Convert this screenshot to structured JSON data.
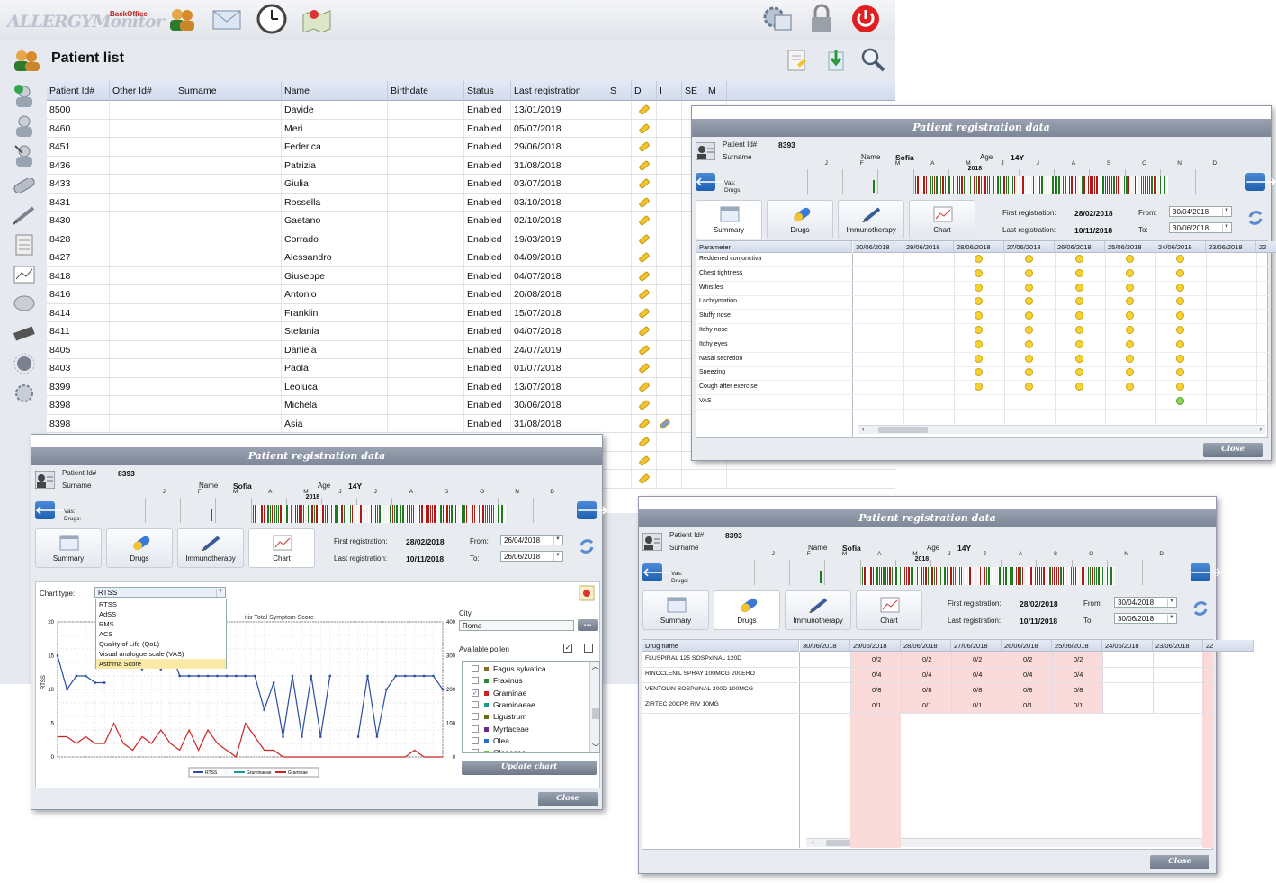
{
  "app": {
    "logo_text": "ALLERGYMonitor",
    "logo_sub": "BackOffice",
    "page_title": "Patient list"
  },
  "toolbar_icons": [
    "patients-icon",
    "mail-icon",
    "clock-icon",
    "map-icon",
    "settings-icon",
    "lock-icon",
    "power-icon"
  ],
  "grid": {
    "columns": [
      "Patient Id#",
      "Other Id#",
      "Surname",
      "Name",
      "Birthdate",
      "Status",
      "Last registration",
      "S",
      "D",
      "I",
      "SE",
      "M"
    ],
    "rows": [
      {
        "id": "8500",
        "name": "Davide",
        "status": "Enabled",
        "last": "13/01/2019"
      },
      {
        "id": "8460",
        "name": "Meri",
        "status": "Enabled",
        "last": "05/07/2018"
      },
      {
        "id": "8451",
        "name": "Federica",
        "status": "Enabled",
        "last": "29/06/2018"
      },
      {
        "id": "8436",
        "name": "Patrizia",
        "status": "Enabled",
        "last": "31/08/2018"
      },
      {
        "id": "8433",
        "name": "Giulia",
        "status": "Enabled",
        "last": "03/07/2018"
      },
      {
        "id": "8431",
        "name": "Rossella",
        "status": "Enabled",
        "last": "03/10/2018"
      },
      {
        "id": "8430",
        "name": "Gaetano",
        "status": "Enabled",
        "last": "02/10/2018"
      },
      {
        "id": "8428",
        "name": "Corrado",
        "status": "Enabled",
        "last": "19/03/2019"
      },
      {
        "id": "8427",
        "name": "Alessandro",
        "status": "Enabled",
        "last": "04/09/2018"
      },
      {
        "id": "8418",
        "name": "Giuseppe",
        "status": "Enabled",
        "last": "04/07/2018"
      },
      {
        "id": "8416",
        "name": "Antonio",
        "status": "Enabled",
        "last": "20/08/2018"
      },
      {
        "id": "8414",
        "name": "Franklin",
        "status": "Enabled",
        "last": "15/07/2018"
      },
      {
        "id": "8411",
        "name": "Stefania",
        "status": "Enabled",
        "last": "04/07/2018"
      },
      {
        "id": "8405",
        "name": "Daniela",
        "status": "Enabled",
        "last": "24/07/2019"
      },
      {
        "id": "8403",
        "name": "Paola",
        "status": "Enabled",
        "last": "01/07/2018"
      },
      {
        "id": "8399",
        "name": "Leoluca",
        "status": "Enabled",
        "last": "13/07/2018"
      },
      {
        "id": "8398",
        "name": "Michela",
        "status": "Enabled",
        "last": "30/06/2018"
      },
      {
        "id": "8398",
        "name": "Asia",
        "status": "Enabled",
        "last": "31/08/2018"
      }
    ]
  },
  "dialog": {
    "title": "Patient registration data",
    "patient_id_label": "Patient Id#",
    "patient_id": "8393",
    "surname_label": "Surname",
    "name_label": "Name",
    "name": "Sofia",
    "age_label": "Age",
    "age": "14Y",
    "year": "2018",
    "months": [
      "J",
      "F",
      "M",
      "A",
      "M",
      "J",
      "J",
      "A",
      "S",
      "O",
      "N",
      "D"
    ],
    "vas_label": "Vas:",
    "drugs_label": "Drugs:",
    "tabs": [
      "Summary",
      "Drugs",
      "Immunotherapy",
      "Chart"
    ],
    "first_reg_label": "First registration:",
    "first_reg": "28/02/2018",
    "last_reg_label": "Last registration:",
    "last_reg": "10/11/2018",
    "from_label": "From:",
    "to_label": "To:",
    "close": "Close"
  },
  "summary_dialog": {
    "from": "30/04/2018",
    "to": "30/06/2018",
    "param_header": "Parameter",
    "dates": [
      "30/06/2018",
      "29/06/2018",
      "28/06/2018",
      "27/06/2018",
      "26/06/2018",
      "25/06/2018",
      "24/06/2018",
      "23/06/2018",
      "22"
    ],
    "parameters": [
      "Reddened conjunctiva",
      "Chest tightness",
      "Whistles",
      "Lachrymation",
      "Stuffy nose",
      "Itchy nose",
      "Itchy eyes",
      "Nasal secretion",
      "Sneezing",
      "Cough after exercise",
      "VAS"
    ]
  },
  "drugs_dialog": {
    "from": "30/04/2018",
    "to": "30/06/2018",
    "drug_header": "Drug name",
    "dates": [
      "30/06/2018",
      "29/06/2018",
      "28/06/2018",
      "27/06/2018",
      "26/06/2018",
      "25/06/2018",
      "24/06/2018",
      "23/06/2018",
      "22"
    ],
    "drugs": [
      {
        "name": "FLUSPIRAL 125 SOSPxINAL 120D",
        "doses": [
          "",
          "0/2",
          "0/2",
          "0/2",
          "0/2",
          "0/2",
          ""
        ]
      },
      {
        "name": "RINOCLENIL SPRAY 100MCG 200ERO",
        "doses": [
          "",
          "0/4",
          "0/4",
          "0/4",
          "0/4",
          "0/4",
          ""
        ]
      },
      {
        "name": "VENTOLIN SOSPxINAL 200D 100MCG",
        "doses": [
          "",
          "0/8",
          "0/8",
          "0/8",
          "0/8",
          "0/8",
          ""
        ]
      },
      {
        "name": "ZIRTEC 20CPR RIV 10MG",
        "doses": [
          "",
          "0/1",
          "0/1",
          "0/1",
          "0/1",
          "0/1",
          ""
        ]
      }
    ]
  },
  "chart_dialog": {
    "from": "26/04/2018",
    "to": "26/06/2018",
    "chart_type_label": "Chart type:",
    "chart_type": "RTSS",
    "chart_options": [
      "RTSS",
      "AdSS",
      "RMS",
      "ACS",
      "Quality of Life (QoL)",
      "Visual analogue scale (VAS)",
      "Asthma Score"
    ],
    "city_label": "City",
    "city": "Roma",
    "city_btn": "...",
    "pollen_label": "Available pollen",
    "pollens": [
      {
        "name": "Fagus sylvatica",
        "color": "#8a6a2a",
        "checked": false
      },
      {
        "name": "Fraxinus",
        "color": "#2a8a3a",
        "checked": false
      },
      {
        "name": "Graminae",
        "color": "#cc2222",
        "checked": true
      },
      {
        "name": "Graminaeae",
        "color": "#1a9a8a",
        "checked": false
      },
      {
        "name": "Ligustrum",
        "color": "#6a6a1a",
        "checked": false
      },
      {
        "name": "Myrtaceae",
        "color": "#6a2a8a",
        "checked": false
      },
      {
        "name": "Olea",
        "color": "#2a6acc",
        "checked": false
      },
      {
        "name": "Oleaceae",
        "color": "#5acc2a",
        "checked": false
      }
    ],
    "update_btn": "Update chart",
    "chart_title_fragment": "itis Total Symptom Score"
  },
  "chart_data": {
    "type": "line",
    "title": "itis Total Symptom Score",
    "ylabel": "RTSS",
    "ylim": [
      0,
      20
    ],
    "y2lim": [
      0,
      400
    ],
    "yticks": [
      0,
      5,
      10,
      15,
      20
    ],
    "y2ticks": [
      0,
      100,
      200,
      300,
      400
    ],
    "legend": [
      "RTSS",
      "Graminaeae",
      "Graminae"
    ],
    "series": [
      {
        "name": "RTSS",
        "color": "#2a4ea0",
        "values": [
          15,
          10,
          12,
          12,
          11,
          11,
          null,
          null,
          null,
          13,
          null,
          13,
          16,
          12,
          12,
          12,
          12,
          12,
          12,
          12,
          12,
          12,
          7,
          11,
          3,
          12,
          3,
          12,
          3,
          12,
          null,
          null,
          3,
          12,
          3,
          10,
          12,
          12,
          12,
          12,
          12,
          10
        ]
      },
      {
        "name": "Graminae",
        "color": "#cc2222",
        "values": [
          3,
          3,
          2,
          3,
          2,
          2,
          5,
          2,
          1,
          3,
          2,
          4,
          2,
          1,
          4,
          1,
          4,
          2,
          1,
          0,
          5,
          3,
          1,
          1,
          0,
          0,
          0,
          0,
          0,
          0,
          0,
          0,
          0,
          0,
          0,
          0,
          0,
          0,
          1,
          0,
          0,
          0
        ]
      }
    ]
  }
}
